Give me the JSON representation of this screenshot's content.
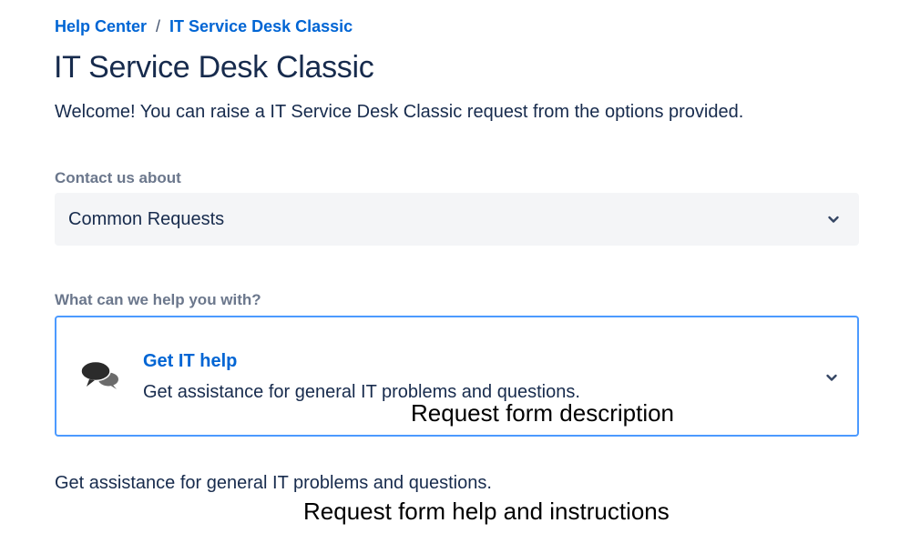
{
  "breadcrumb": {
    "root": "Help Center",
    "separator": "/",
    "current": "IT Service Desk Classic"
  },
  "page": {
    "title": "IT Service Desk Classic",
    "welcome": "Welcome! You can raise a IT Service Desk Classic request from the options provided."
  },
  "contact": {
    "label": "Contact us about",
    "selected": "Common Requests",
    "icon": "chevron-down-icon"
  },
  "help": {
    "label": "What can we help you with?",
    "request": {
      "title": "Get IT help",
      "description": "Get assistance for general IT problems and questions.",
      "icon": "speech-bubbles-icon",
      "chevron_icon": "chevron-down-icon"
    },
    "help_text": "Get assistance for general IT problems and questions."
  },
  "annotations": {
    "description": "Request form description",
    "help": "Request form help and instructions"
  },
  "colors": {
    "link": "#0065d4",
    "text": "#172b4d",
    "label": "#6b778c",
    "select_bg": "#f4f5f7",
    "focus_border": "#4c9aff"
  }
}
